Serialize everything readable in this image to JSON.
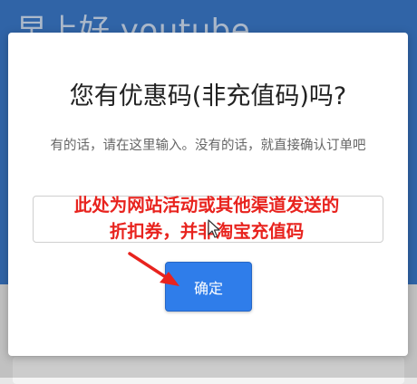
{
  "background": {
    "title": "早上好 youtube"
  },
  "modal": {
    "title": "您有优惠码(非充值码)吗?",
    "description": "有的话，请在这里输入。没有的话，就直接确认订单吧",
    "input_value": "",
    "confirm_label": "确定"
  },
  "annotation": {
    "line1": "此处为网站活动或其他渠道发送的",
    "line2": "折扣券，并非淘宝充值码",
    "color": "#e8231e"
  },
  "icons": {
    "arrow": "red-arrow-icon",
    "cursor": "mouse-cursor-icon"
  },
  "colors": {
    "header": "#3a78c8",
    "button": "#2f7dea"
  }
}
